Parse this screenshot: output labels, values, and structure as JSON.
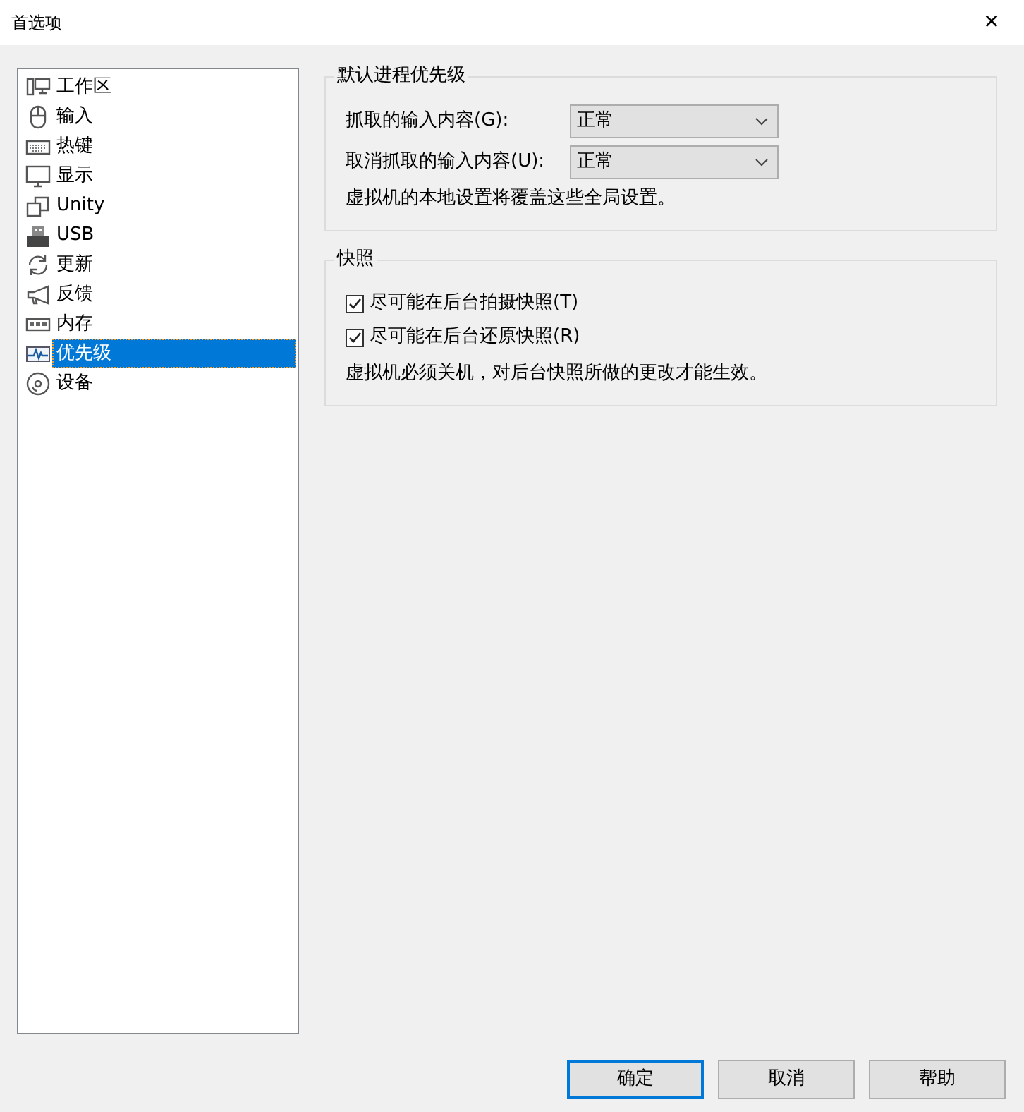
{
  "window": {
    "title": "首选项",
    "close": "✕"
  },
  "sidebar": {
    "items": [
      {
        "label": "工作区",
        "selected": false
      },
      {
        "label": "输入",
        "selected": false
      },
      {
        "label": "热键",
        "selected": false
      },
      {
        "label": "显示",
        "selected": false
      },
      {
        "label": "Unity",
        "selected": false
      },
      {
        "label": "USB",
        "selected": false
      },
      {
        "label": "更新",
        "selected": false
      },
      {
        "label": "反馈",
        "selected": false
      },
      {
        "label": "内存",
        "selected": false
      },
      {
        "label": "优先级",
        "selected": true
      },
      {
        "label": "设备",
        "selected": false
      }
    ]
  },
  "priority_group": {
    "title": "默认进程优先级",
    "fields": [
      {
        "label": "抓取的输入内容(G):",
        "value": "正常"
      },
      {
        "label": "取消抓取的输入内容(U):",
        "value": "正常"
      }
    ],
    "note": "虚拟机的本地设置将覆盖这些全局设置。"
  },
  "snapshot_group": {
    "title": "快照",
    "options": [
      {
        "label": "尽可能在后台拍摄快照(T)",
        "checked": true
      },
      {
        "label": "尽可能在后台还原快照(R)",
        "checked": true
      }
    ],
    "note": "虚拟机必须关机，对后台快照所做的更改才能生效。"
  },
  "buttons": [
    {
      "label": "确定",
      "default": true
    },
    {
      "label": "取消",
      "default": false
    },
    {
      "label": "帮助",
      "default": false
    }
  ]
}
